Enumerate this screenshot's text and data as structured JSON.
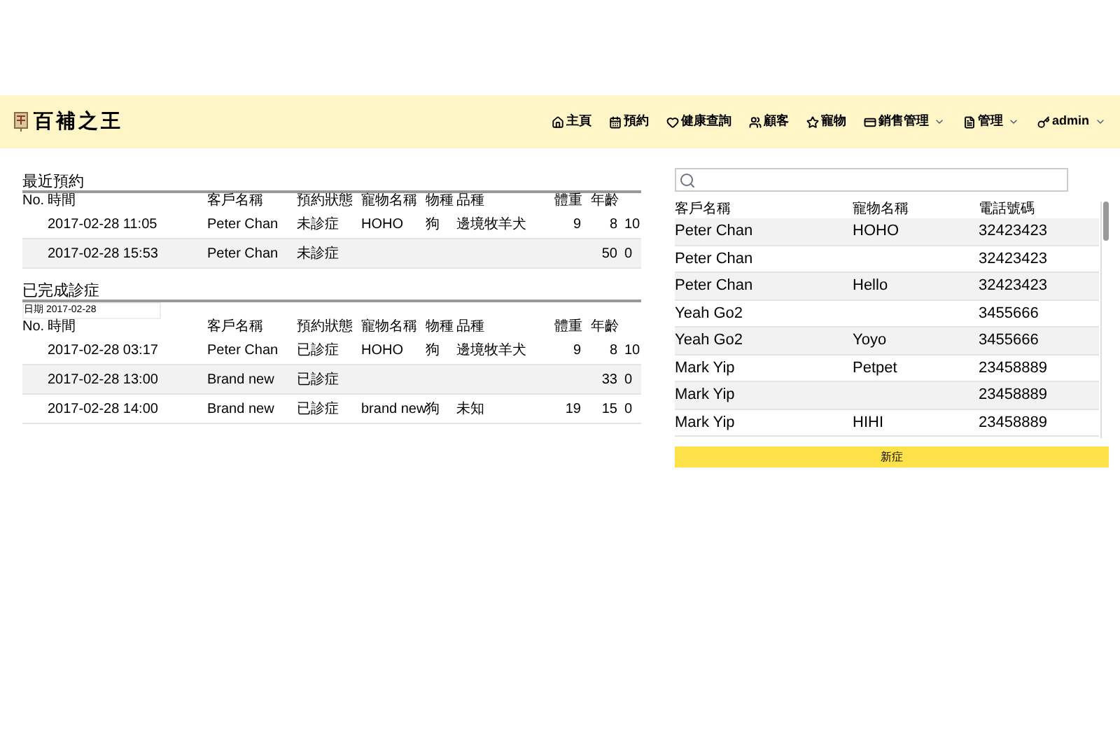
{
  "brand": {
    "name": "百補之王"
  },
  "nav": [
    {
      "label": "主頁",
      "dropdown": false
    },
    {
      "label": "預約",
      "dropdown": false
    },
    {
      "label": "健康查詢",
      "dropdown": false
    },
    {
      "label": "顧客",
      "dropdown": false
    },
    {
      "label": "寵物",
      "dropdown": false
    },
    {
      "label": "銷售管理",
      "dropdown": true
    },
    {
      "label": "管理",
      "dropdown": true
    },
    {
      "label": "admin",
      "dropdown": true
    }
  ],
  "recent": {
    "title": "最近預約",
    "columns": [
      "No.",
      "時間",
      "客戶名稱",
      "預約狀態",
      "寵物名稱",
      "物種",
      "品種",
      "體重",
      "年齡"
    ],
    "rows": [
      [
        "",
        "2017-02-28 11:05",
        "Peter Chan",
        "未診症",
        "HOHO",
        "狗",
        "邊境牧羊犬",
        "9",
        "8",
        "10"
      ],
      [
        "",
        "2017-02-28 15:53",
        "Peter Chan",
        "未診症",
        "",
        "",
        "",
        "",
        "50",
        "0"
      ]
    ]
  },
  "done": {
    "title": "已完成診症",
    "date_label": "日期",
    "date": "2017-02-28",
    "columns": [
      "No.",
      "時間",
      "客戶名稱",
      "預約狀態",
      "寵物名稱",
      "物種",
      "品種",
      "體重",
      "年齡"
    ],
    "rows": [
      [
        "",
        "2017-02-28 03:17",
        "Peter Chan",
        "已診症",
        "HOHO",
        "狗",
        "邊境牧羊犬",
        "9",
        "8",
        "10"
      ],
      [
        "",
        "2017-02-28 13:00",
        "Brand new",
        "已診症",
        "",
        "",
        "",
        "",
        "33",
        "0"
      ],
      [
        "",
        "2017-02-28 14:00",
        "Brand new",
        "已診症",
        "brand new",
        "狗",
        "未知",
        "19",
        "15",
        "0"
      ]
    ]
  },
  "clients": {
    "columns": [
      "客戶名稱",
      "寵物名稱",
      "電話號碼"
    ],
    "rows": [
      [
        "Peter Chan",
        "HOHO",
        "32423423"
      ],
      [
        "Peter Chan",
        "",
        "32423423"
      ],
      [
        "Peter Chan",
        "Hello",
        "32423423"
      ],
      [
        "Yeah Go2",
        "",
        "3455666"
      ],
      [
        "Yeah Go2",
        "Yoyo",
        "3455666"
      ],
      [
        "Mark Yip",
        "Petpet",
        "23458889"
      ],
      [
        "Mark Yip",
        "",
        "23458889"
      ],
      [
        "Mark Yip",
        "HIHI",
        "23458889"
      ]
    ]
  },
  "new_button": "新症"
}
